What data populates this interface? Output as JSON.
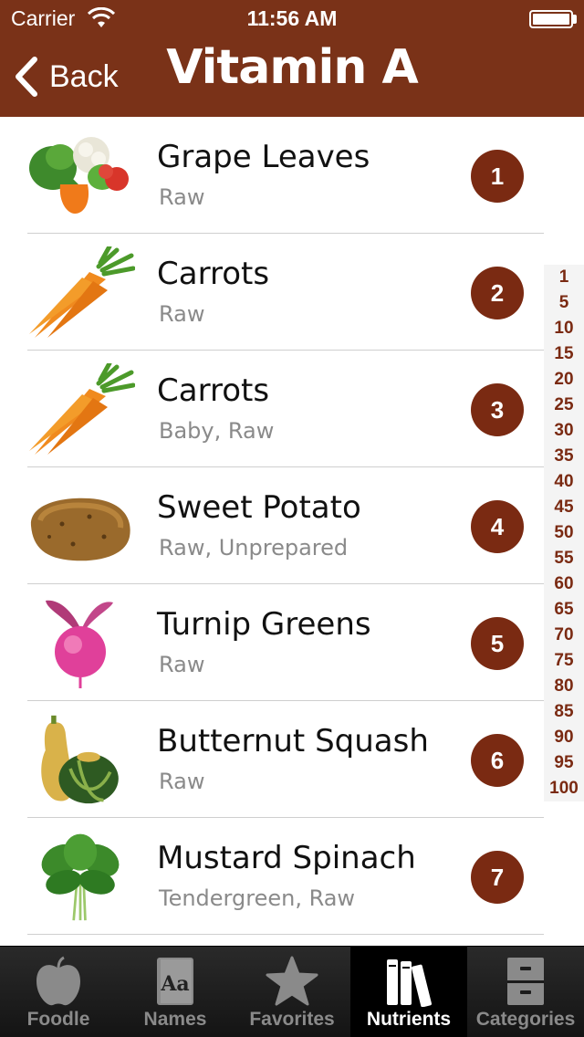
{
  "status_bar": {
    "carrier": "Carrier",
    "time": "11:56 AM"
  },
  "nav": {
    "back_label": "Back",
    "title": "Vitamin A"
  },
  "foods": [
    {
      "name": "Grape Leaves",
      "detail": "Raw",
      "rank": "1",
      "icon": "vegetables-icon"
    },
    {
      "name": "Carrots",
      "detail": "Raw",
      "rank": "2",
      "icon": "carrot-icon"
    },
    {
      "name": "Carrots",
      "detail": "Baby, Raw",
      "rank": "3",
      "icon": "carrot-icon"
    },
    {
      "name": "Sweet Potato",
      "detail": "Raw, Unprepared",
      "rank": "4",
      "icon": "potato-icon"
    },
    {
      "name": "Turnip Greens",
      "detail": "Raw",
      "rank": "5",
      "icon": "turnip-icon"
    },
    {
      "name": "Butternut Squash",
      "detail": "Raw",
      "rank": "6",
      "icon": "squash-icon"
    },
    {
      "name": "Mustard Spinach",
      "detail": "Tendergreen, Raw",
      "rank": "7",
      "icon": "leafy-greens-icon"
    }
  ],
  "index": [
    "1",
    "5",
    "10",
    "15",
    "20",
    "25",
    "30",
    "35",
    "40",
    "45",
    "50",
    "55",
    "60",
    "65",
    "70",
    "75",
    "80",
    "85",
    "90",
    "95",
    "100"
  ],
  "tabs": [
    {
      "label": "Foodle",
      "icon": "apple-icon",
      "active": false
    },
    {
      "label": "Names",
      "icon": "dictionary-icon",
      "active": false
    },
    {
      "label": "Favorites",
      "icon": "star-icon",
      "active": false
    },
    {
      "label": "Nutrients",
      "icon": "books-icon",
      "active": true
    },
    {
      "label": "Categories",
      "icon": "cabinet-icon",
      "active": false
    }
  ],
  "colors": {
    "nav_bar": "#7a3218",
    "rank_badge": "#7a2a12",
    "index_text": "#7a2a12",
    "tab_bar": "#1c1c1c"
  }
}
